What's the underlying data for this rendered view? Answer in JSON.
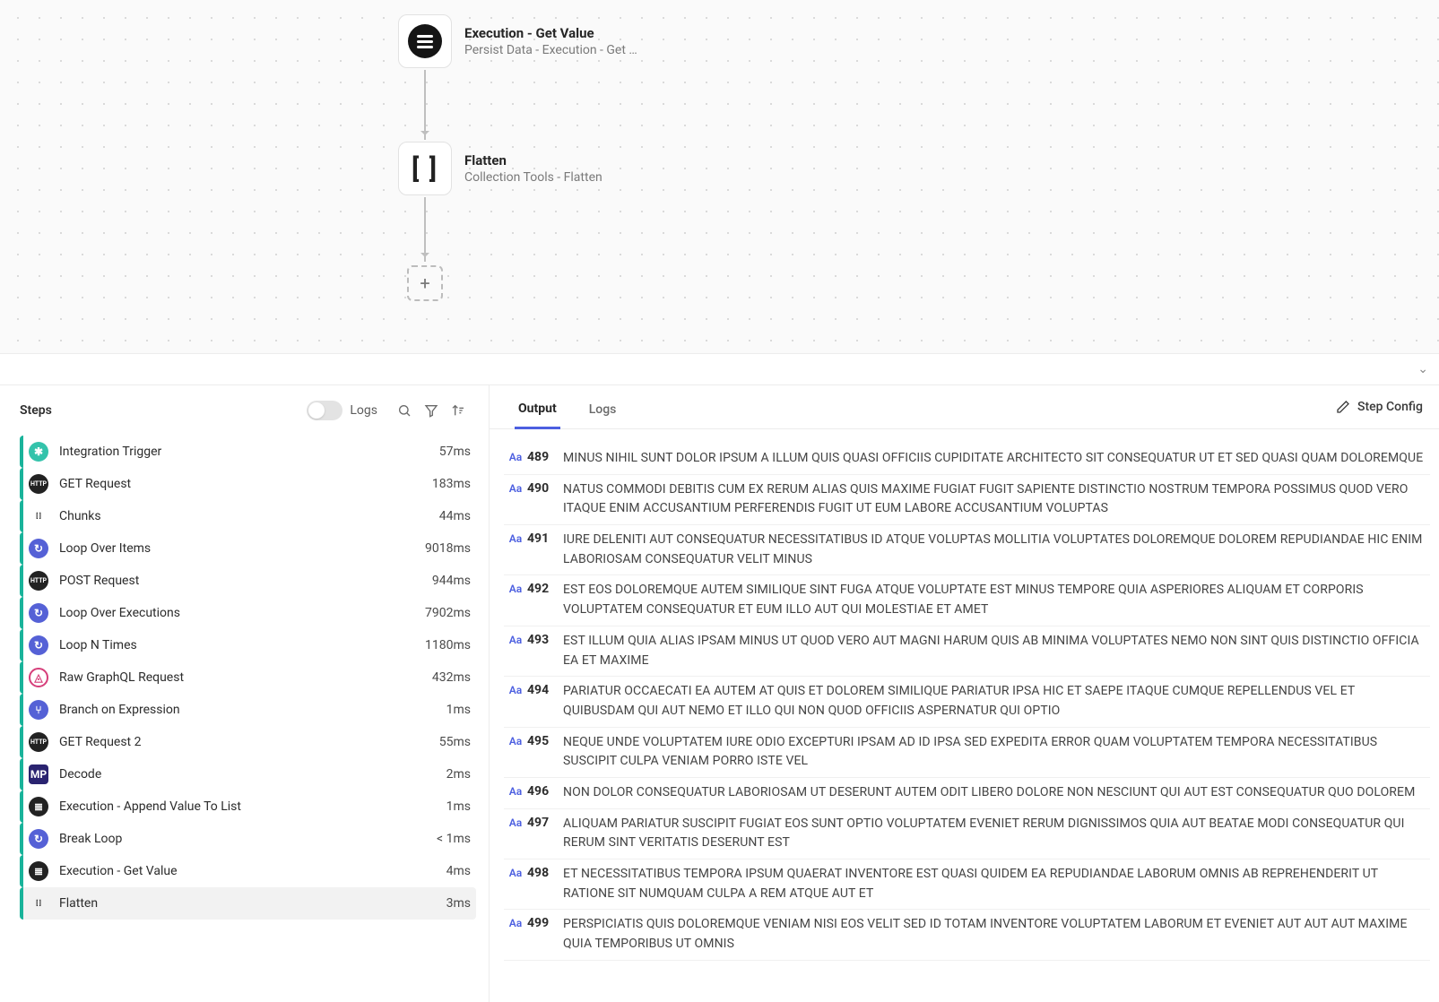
{
  "canvas": {
    "node1": {
      "title": "Execution - Get Value",
      "subtitle": "Persist Data - Execution - Get …"
    },
    "node2": {
      "title": "Flatten",
      "subtitle": "Collection Tools - Flatten"
    },
    "add": "+"
  },
  "left": {
    "title": "Steps",
    "logsLabel": "Logs",
    "steps": [
      {
        "name": "Integration Trigger",
        "time": "57ms",
        "icon": "teal",
        "glyph": "✱"
      },
      {
        "name": "GET Request",
        "time": "183ms",
        "icon": "dark",
        "glyph": "HTTP"
      },
      {
        "name": "Chunks",
        "time": "44ms",
        "icon": "brackets",
        "glyph": "[ ]"
      },
      {
        "name": "Loop Over Items",
        "time": "9018ms",
        "icon": "loop",
        "glyph": "↻"
      },
      {
        "name": "POST Request",
        "time": "944ms",
        "icon": "dark",
        "glyph": "HTTP"
      },
      {
        "name": "Loop Over Executions",
        "time": "7902ms",
        "icon": "loop",
        "glyph": "↻"
      },
      {
        "name": "Loop N Times",
        "time": "1180ms",
        "icon": "loop",
        "glyph": "↻"
      },
      {
        "name": "Raw GraphQL Request",
        "time": "432ms",
        "icon": "graphql",
        "glyph": "◬"
      },
      {
        "name": "Branch on Expression",
        "time": "1ms",
        "icon": "branch",
        "glyph": "⑂"
      },
      {
        "name": "GET Request 2",
        "time": "55ms",
        "icon": "dark",
        "glyph": "HTTP"
      },
      {
        "name": "Decode",
        "time": "2ms",
        "icon": "mp",
        "glyph": "MP"
      },
      {
        "name": "Execution - Append Value To List",
        "time": "1ms",
        "icon": "dark",
        "glyph": "≣"
      },
      {
        "name": "Break Loop",
        "time": "< 1ms",
        "icon": "loop",
        "glyph": "↻"
      },
      {
        "name": "Execution - Get Value",
        "time": "4ms",
        "icon": "dark",
        "glyph": "≣"
      },
      {
        "name": "Flatten",
        "time": "3ms",
        "icon": "brackets",
        "glyph": "[ ]",
        "selected": true
      }
    ]
  },
  "right": {
    "tabs": {
      "output": "Output",
      "logs": "Logs"
    },
    "stepConfig": "Step Config",
    "rows": [
      {
        "idx": "489",
        "text": "MINUS NIHIL SUNT DOLOR IPSUM A ILLUM QUIS QUASI OFFICIIS CUPIDITATE ARCHITECTO SIT CONSEQUATUR UT ET SED QUASI QUAM DOLOREMQUE"
      },
      {
        "idx": "490",
        "text": "NATUS COMMODI DEBITIS CUM EX RERUM ALIAS QUIS MAXIME FUGIAT FUGIT SAPIENTE DISTINCTIO NOSTRUM TEMPORA POSSIMUS QUOD VERO ITAQUE ENIM ACCUSANTIUM PERFERENDIS FUGIT UT EUM LABORE ACCUSANTIUM VOLUPTAS"
      },
      {
        "idx": "491",
        "text": "IURE DELENITI AUT CONSEQUATUR NECESSITATIBUS ID ATQUE VOLUPTAS MOLLITIA VOLUPTATES DOLOREMQUE DOLOREM REPUDIANDAE HIC ENIM LABORIOSAM CONSEQUATUR VELIT MINUS"
      },
      {
        "idx": "492",
        "text": "EST EOS DOLOREMQUE AUTEM SIMILIQUE SINT FUGA ATQUE VOLUPTATE EST MINUS TEMPORE QUIA ASPERIORES ALIQUAM ET CORPORIS VOLUPTATEM CONSEQUATUR ET EUM ILLO AUT QUI MOLESTIAE ET AMET"
      },
      {
        "idx": "493",
        "text": "EST ILLUM QUIA ALIAS IPSAM MINUS UT QUOD VERO AUT MAGNI HARUM QUIS AB MINIMA VOLUPTATES NEMO NON SINT QUIS DISTINCTIO OFFICIA EA ET MAXIME"
      },
      {
        "idx": "494",
        "text": "PARIATUR OCCAECATI EA AUTEM AT QUIS ET DOLOREM SIMILIQUE PARIATUR IPSA HIC ET SAEPE ITAQUE CUMQUE REPELLENDUS VEL ET QUIBUSDAM QUI AUT NEMO ET ILLO QUI NON QUOD OFFICIIS ASPERNATUR QUI OPTIO"
      },
      {
        "idx": "495",
        "text": "NEQUE UNDE VOLUPTATEM IURE ODIO EXCEPTURI IPSAM AD ID IPSA SED EXPEDITA ERROR QUAM VOLUPTATEM TEMPORA NECESSITATIBUS SUSCIPIT CULPA VENIAM PORRO ISTE VEL"
      },
      {
        "idx": "496",
        "text": "NON DOLOR CONSEQUATUR LABORIOSAM UT DESERUNT AUTEM ODIT LIBERO DOLORE NON NESCIUNT QUI AUT EST CONSEQUATUR QUO DOLOREM"
      },
      {
        "idx": "497",
        "text": "ALIQUAM PARIATUR SUSCIPIT FUGIAT EOS SUNT OPTIO VOLUPTATEM EVENIET RERUM DIGNISSIMOS QUIA AUT BEATAE MODI CONSEQUATUR QUI RERUM SINT VERITATIS DESERUNT EST"
      },
      {
        "idx": "498",
        "text": "ET NECESSITATIBUS TEMPORA IPSUM QUAERAT INVENTORE EST QUASI QUIDEM EA REPUDIANDAE LABORUM OMNIS AB REPREHENDERIT UT RATIONE SIT NUMQUAM CULPA A REM ATQUE AUT ET"
      },
      {
        "idx": "499",
        "text": "PERSPICIATIS QUIS DOLOREMQUE VENIAM NISI EOS VELIT SED ID TOTAM INVENTORE VOLUPTATEM LABORUM ET EVENIET AUT AUT AUT MAXIME QUIA TEMPORIBUS UT OMNIS"
      }
    ]
  }
}
